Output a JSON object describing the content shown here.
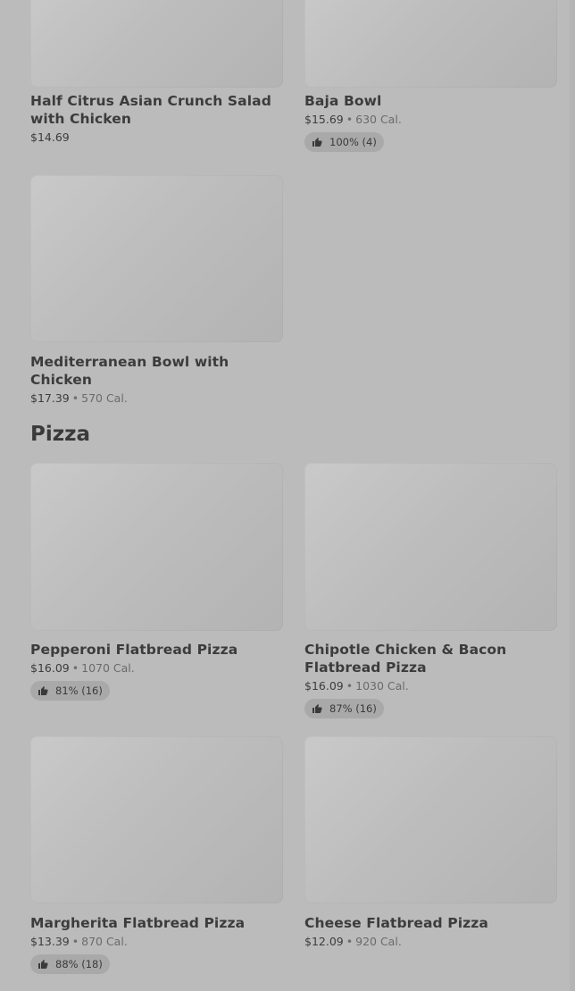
{
  "sections": {
    "pizza_title": "Pizza"
  },
  "items": {
    "half_citrus": {
      "name": "Half Citrus Asian Crunch Salad with Chicken",
      "price": "$14.69"
    },
    "baja_bowl": {
      "name": "Baja Bowl",
      "price": "$15.69",
      "calories": "630 Cal.",
      "rating": "100% (4)"
    },
    "mediterranean": {
      "name": "Mediterranean Bowl with Chicken",
      "price": "$17.39",
      "calories": "570 Cal."
    },
    "pepperoni": {
      "name": "Pepperoni Flatbread Pizza",
      "price": "$16.09",
      "calories": "1070 Cal.",
      "rating": "81% (16)"
    },
    "chipotle": {
      "name": "Chipotle Chicken & Bacon Flatbread Pizza",
      "price": "$16.09",
      "calories": "1030 Cal.",
      "rating": "87% (16)"
    },
    "margherita": {
      "name": "Margherita Flatbread Pizza",
      "price": "$13.39",
      "calories": "870 Cal.",
      "rating": "88% (18)"
    },
    "cheese": {
      "name": "Cheese Flatbread Pizza",
      "price": "$12.09",
      "calories": "920 Cal."
    }
  },
  "icons": {
    "rating": "thumbs-up-icon"
  },
  "colors": {
    "overlay_background": "#bbbbbb",
    "badge_background": "#a9a9a9"
  },
  "separator": "•"
}
